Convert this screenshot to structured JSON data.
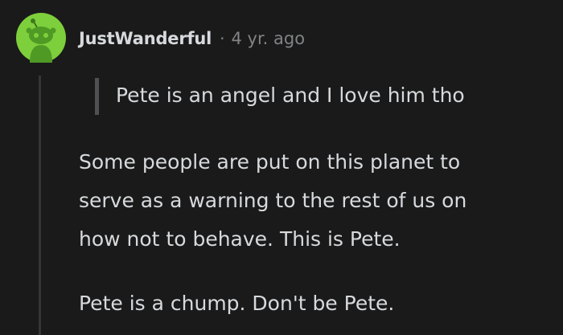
{
  "comment": {
    "author": "JustWanderful",
    "separator": "·",
    "age": "4 yr. ago",
    "quote": "Pete is an angel and I love him tho",
    "paragraphs": [
      {
        "lines": [
          "Some people are put on this planet to",
          "serve as a warning to the rest of us on",
          "how not to behave. This is Pete."
        ]
      },
      {
        "lines": [
          "Pete is a chump. Don't be Pete."
        ]
      }
    ]
  },
  "colors": {
    "background": "#1a1a1b",
    "text": "#d7dadc",
    "muted": "#818384",
    "avatar_bg": "#7ecf3c",
    "thread_line": "#343536"
  },
  "icons": {
    "avatar": "snoo-avatar-icon"
  }
}
